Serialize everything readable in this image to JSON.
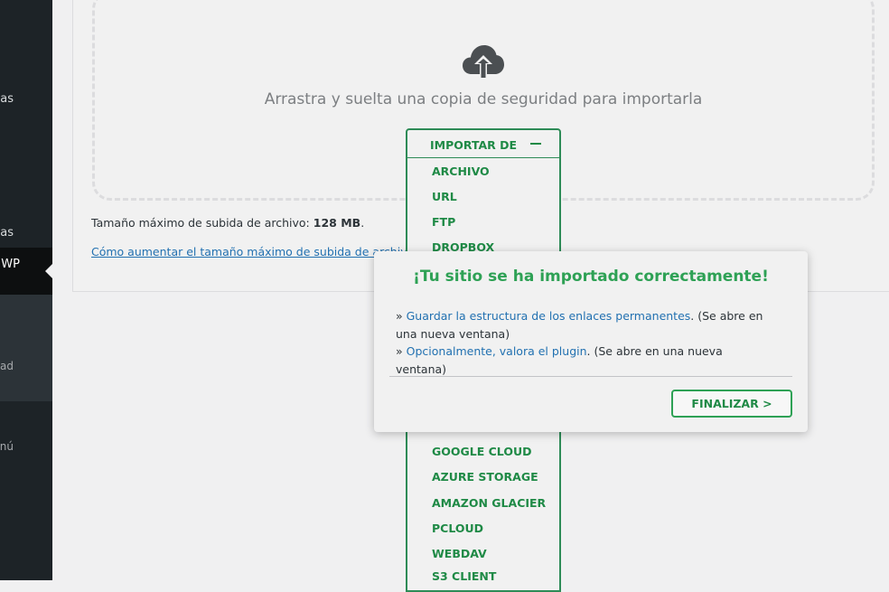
{
  "sidebar": {
    "items": [
      {
        "label": "Entradas"
      },
      {
        "label": "Herramientas"
      },
      {
        "label": "All-in-One WP"
      },
      {
        "label": "Copias de seguridad"
      },
      {
        "label": "Cerrar menú"
      }
    ]
  },
  "dropzone": {
    "icon": "cloud-upload-icon",
    "text": "Arrastra y suelta una copia de seguridad para importarla"
  },
  "max_upload": {
    "label": "Tamaño máximo de subida de archivo:",
    "value": "128 MB",
    "suffix": ".",
    "link": "Cómo aumentar el tamaño máximo de subida de archivo"
  },
  "import_menu": {
    "button_label": "IMPORTAR DE",
    "options": [
      "ARCHIVO",
      "URL",
      "FTP",
      "DROPBOX",
      "GOOGLE CLOUD",
      "AZURE STORAGE",
      "AMAZON GLACIER",
      "PCLOUD",
      "WEBDAV",
      "S3 CLIENT"
    ]
  },
  "modal": {
    "title": "¡Tu sitio se ha importado correctamente!",
    "line1_prefix": "» ",
    "line1_link": "Guardar la estructura de los enlaces permanentes",
    "line1_suffix": ". (Se abre en una nueva ventana)",
    "line2_prefix": "» ",
    "line2_link": "Opcionalmente, valora el plugin",
    "line2_suffix": ". (Se abre en una nueva ventana)",
    "finish_button": "FINALIZAR >"
  },
  "colors": {
    "accent_green": "#2ea155",
    "link_blue": "#2271b1",
    "sidebar_bg": "#1d2327"
  }
}
